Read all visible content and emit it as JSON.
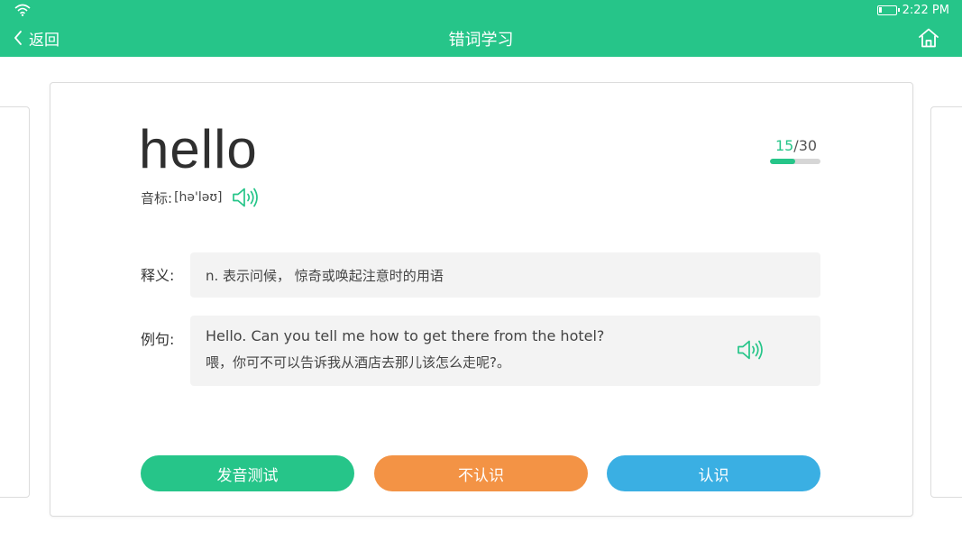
{
  "status_bar": {
    "time": "2:22 PM",
    "battery_level": 0.2
  },
  "header": {
    "back_label": "返回",
    "title": "错词学习"
  },
  "word_card": {
    "word": "hello",
    "phonetic_label": "音标:",
    "phonetic": "[hə'ləʊ]",
    "progress": {
      "current": "15",
      "separator": "/",
      "total": "30",
      "fraction": 0.5
    },
    "definition_label": "释义:",
    "definition": "n. 表示问候， 惊奇或唤起注意时的用语",
    "example_label": "例句:",
    "example_en": "Hello. Can you tell me how to get there from the hotel?",
    "example_zh": "喂，你可不可以告诉我从酒店去那儿该怎么走呢?。"
  },
  "actions": {
    "pronounce_test": "发音测试",
    "unknown": "不认识",
    "known": "认识"
  },
  "colors": {
    "primary": "#26c589",
    "orange": "#f39345",
    "blue": "#3aafe3",
    "panel_bg": "#f3f3f3"
  },
  "icons": [
    "wifi-icon",
    "battery-icon",
    "chevron-left-icon",
    "home-icon",
    "speaker-icon"
  ]
}
